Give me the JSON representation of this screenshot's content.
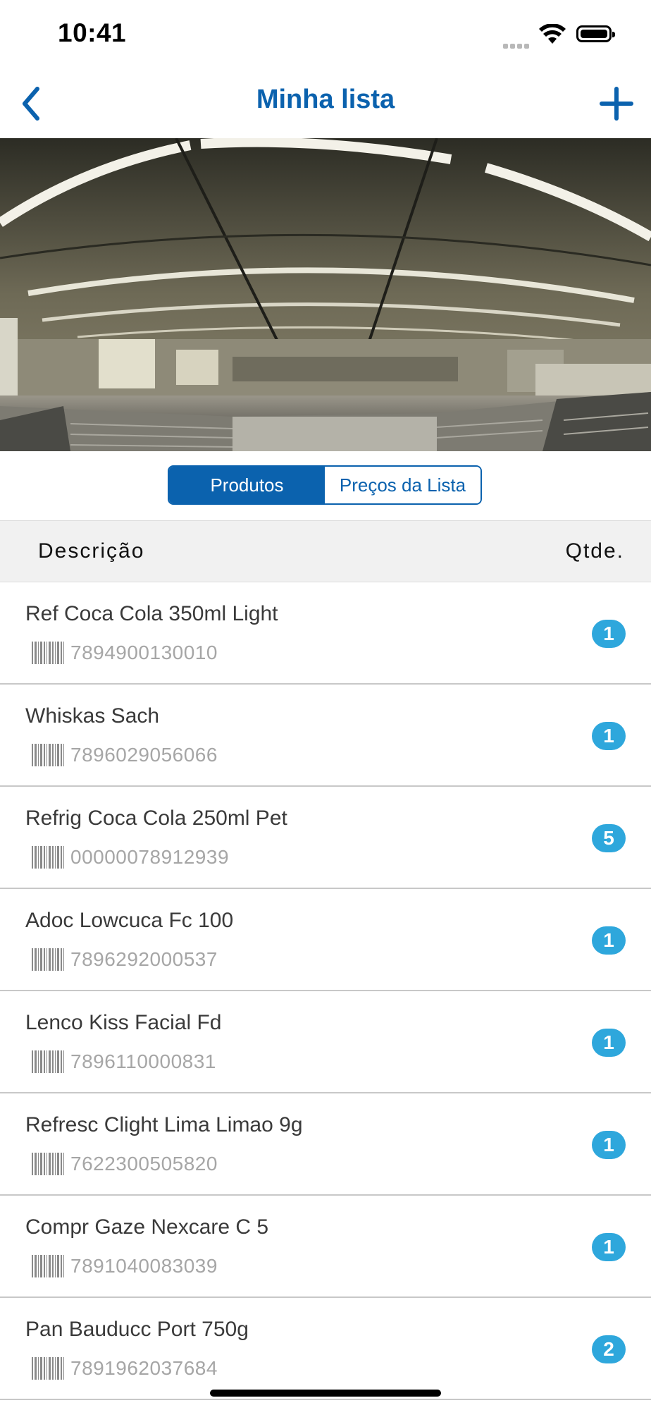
{
  "status_bar": {
    "time": "10:41"
  },
  "nav": {
    "title": "Minha lista"
  },
  "segments": [
    {
      "label": "Produtos",
      "active": true
    },
    {
      "label": "Preços da Lista",
      "active": false
    }
  ],
  "table": {
    "header": {
      "description": "Descrição",
      "quantity": "Qtde."
    },
    "rows": [
      {
        "name": "Ref Coca Cola 350ml Light",
        "barcode": "7894900130010",
        "qty": "1"
      },
      {
        "name": "Whiskas Sach",
        "barcode": "7896029056066",
        "qty": "1"
      },
      {
        "name": "Refrig Coca Cola 250ml Pet",
        "barcode": "00000078912939",
        "qty": "5"
      },
      {
        "name": "Adoc Lowcuca Fc 100",
        "barcode": "7896292000537",
        "qty": "1"
      },
      {
        "name": "Lenco Kiss Facial Fd",
        "barcode": "7896110000831",
        "qty": "1"
      },
      {
        "name": "Refresc Clight Lima Limao 9g",
        "barcode": "7622300505820",
        "qty": "1"
      },
      {
        "name": "Compr Gaze Nexcare C 5",
        "barcode": "7891040083039",
        "qty": "1"
      },
      {
        "name": "Pan Bauducc Port 750g",
        "barcode": "7891962037684",
        "qty": "2"
      }
    ]
  },
  "colors": {
    "accent": "#0b62ae",
    "badge": "#2ea7dc",
    "header_bg": "#f1f1f1"
  },
  "icons": {
    "back": "chevron-left-icon",
    "add": "plus-icon",
    "barcode": "barcode-icon",
    "wifi": "wifi-icon",
    "battery": "battery-icon",
    "signal": "cellular-signal-icon"
  }
}
